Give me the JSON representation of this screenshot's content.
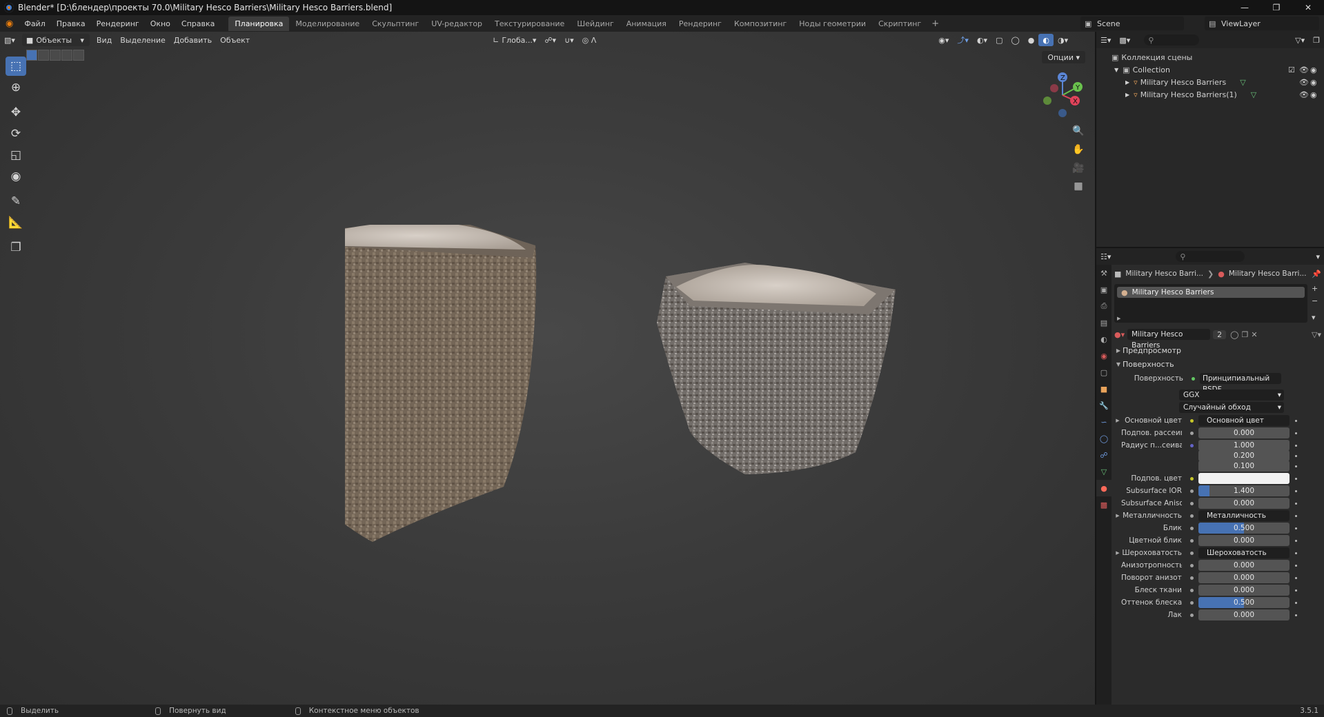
{
  "window": {
    "title": "Blender* [D:\\блендер\\проекты 70.0\\Military Hesco Barriers\\Military Hesco Barriers.blend]"
  },
  "menu": [
    "Файл",
    "Правка",
    "Рендеринг",
    "Окно",
    "Справка"
  ],
  "workspaces": [
    "Планировка",
    "Моделирование",
    "Скульптинг",
    "UV-редактор",
    "Текстурирование",
    "Шейдинг",
    "Анимация",
    "Рендеринг",
    "Композитинг",
    "Ноды геометрии",
    "Скриптинг"
  ],
  "scene": "Scene",
  "view_layer": "ViewLayer",
  "viewport": {
    "mode": "Объекты",
    "menus": [
      "Вид",
      "Выделение",
      "Добавить",
      "Объект"
    ],
    "orientation": "Глоба...",
    "options": "Опции"
  },
  "outliner": {
    "root": "Коллекция сцены",
    "collection": "Collection",
    "objects": [
      "Military Hesco Barriers",
      "Military Hesco Barriers(1)"
    ]
  },
  "properties": {
    "breadcrumb_object": "Military Hesco Barri...",
    "breadcrumb_material": "Military Hesco Barri...",
    "material_slot": "Military Hesco Barriers",
    "material_name": "Military Hesco Barriers",
    "users": "2",
    "sections": {
      "preview": "Предпросмотр",
      "surface": "Поверхность"
    },
    "surface_label": "Поверхность",
    "surface_shader": "Принципиальный BSDF",
    "distribution": "GGX",
    "subsurface_method": "Случайный обход",
    "rows": [
      {
        "label": "Основной цвет",
        "kind": "link",
        "value": "Основной цвет",
        "socket": "#c7c729"
      },
      {
        "label": "Подпов. рассеива...",
        "kind": "num",
        "value": "0.000",
        "fill": 0,
        "socket": "#a1a1a1"
      },
      {
        "label": "Радиус п...сеивания",
        "kind": "num",
        "value": "1.000",
        "fill": 0,
        "socket": "#6363c7"
      },
      {
        "label": "",
        "kind": "num",
        "value": "0.200",
        "fill": 0
      },
      {
        "label": "",
        "kind": "num",
        "value": "0.100",
        "fill": 0
      },
      {
        "label": "Подпов. цвет",
        "kind": "color",
        "value": "",
        "socket": "#c7c729"
      },
      {
        "label": "Subsurface IOR",
        "kind": "num",
        "value": "1.400",
        "fill": 0.12,
        "socket": "#a1a1a1"
      },
      {
        "label": "Subsurface Anisotr...",
        "kind": "num",
        "value": "0.000",
        "fill": 0,
        "socket": "#a1a1a1"
      },
      {
        "label": "Металличность",
        "kind": "link",
        "value": "Металличность",
        "socket": "#a1a1a1"
      },
      {
        "label": "Блик",
        "kind": "num",
        "value": "0.500",
        "fill": 0.5,
        "socket": "#a1a1a1"
      },
      {
        "label": "Цветной блик",
        "kind": "num",
        "value": "0.000",
        "fill": 0,
        "socket": "#a1a1a1"
      },
      {
        "label": "Шероховатость",
        "kind": "link",
        "value": "Шероховатость",
        "socket": "#a1a1a1"
      },
      {
        "label": "Анизотропность",
        "kind": "num",
        "value": "0.000",
        "fill": 0,
        "socket": "#a1a1a1"
      },
      {
        "label": "Поворот анизотро...",
        "kind": "num",
        "value": "0.000",
        "fill": 0,
        "socket": "#a1a1a1"
      },
      {
        "label": "Блеск ткани",
        "kind": "num",
        "value": "0.000",
        "fill": 0,
        "socket": "#a1a1a1"
      },
      {
        "label": "Оттенок блеска тк...",
        "kind": "num",
        "value": "0.500",
        "fill": 0.5,
        "socket": "#a1a1a1"
      },
      {
        "label": "Лак",
        "kind": "num",
        "value": "0.000",
        "fill": 0,
        "socket": "#a1a1a1"
      }
    ]
  },
  "statusbar": {
    "select": "Выделить",
    "rotate": "Повернуть вид",
    "context": "Контекстное меню объектов",
    "version": "3.5.1"
  },
  "colors": {
    "accent": "#4772b3",
    "header": "#232323",
    "panel": "#2b2b2b"
  }
}
